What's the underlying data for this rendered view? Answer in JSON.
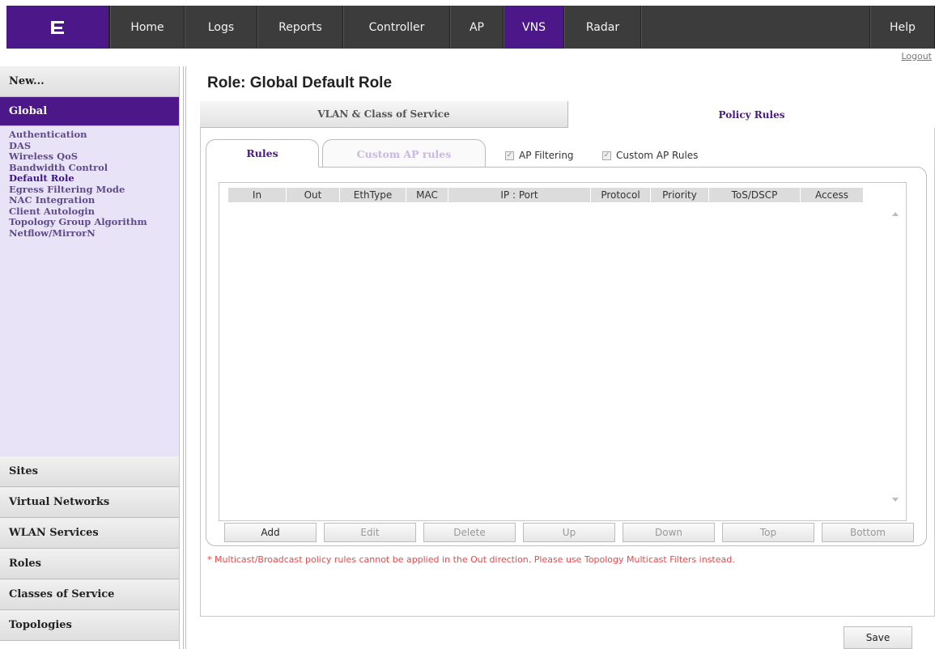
{
  "nav": {
    "logo": "E",
    "items": [
      "Home",
      "Logs",
      "Reports",
      "Controller",
      "AP",
      "VNS",
      "Radar"
    ],
    "help": "Help",
    "active": "VNS"
  },
  "logout": "Logout",
  "sidebar": {
    "new": "New...",
    "global": "Global",
    "global_items": [
      "Authentication",
      "DAS",
      "Wireless QoS",
      "Bandwidth Control",
      "Default Role",
      "Egress Filtering Mode",
      "NAC Integration",
      "Client Autologin",
      "Topology Group Algorithm",
      "Netflow/MirrorN"
    ],
    "selected_item": "Default Role",
    "sections": [
      "Sites",
      "Virtual Networks",
      "WLAN Services",
      "Roles",
      "Classes of Service",
      "Topologies"
    ]
  },
  "page_title": "Role: Global Default Role",
  "tabs": {
    "vlan": "VLAN & Class of Service",
    "policy": "Policy Rules"
  },
  "subtabs": {
    "rules": "Rules",
    "custom": "Custom AP rules"
  },
  "checkboxes": {
    "ap_filtering": "AP Filtering",
    "custom_ap_rules": "Custom AP Rules"
  },
  "grid_columns": [
    "In",
    "Out",
    "EthType",
    "MAC",
    "IP : Port",
    "Protocol",
    "Priority",
    "ToS/DSCP",
    "Access"
  ],
  "buttons": [
    "Add",
    "Edit",
    "Delete",
    "Up",
    "Down",
    "Top",
    "Bottom"
  ],
  "note": "* Multicast/Broadcast policy rules cannot be applied in the Out direction. Please use Topology Multicast Filters instead.",
  "save": "Save",
  "colors": {
    "accent": "#4b1789",
    "nav_bg": "#3c3c3c",
    "warning": "#e84a4a"
  }
}
